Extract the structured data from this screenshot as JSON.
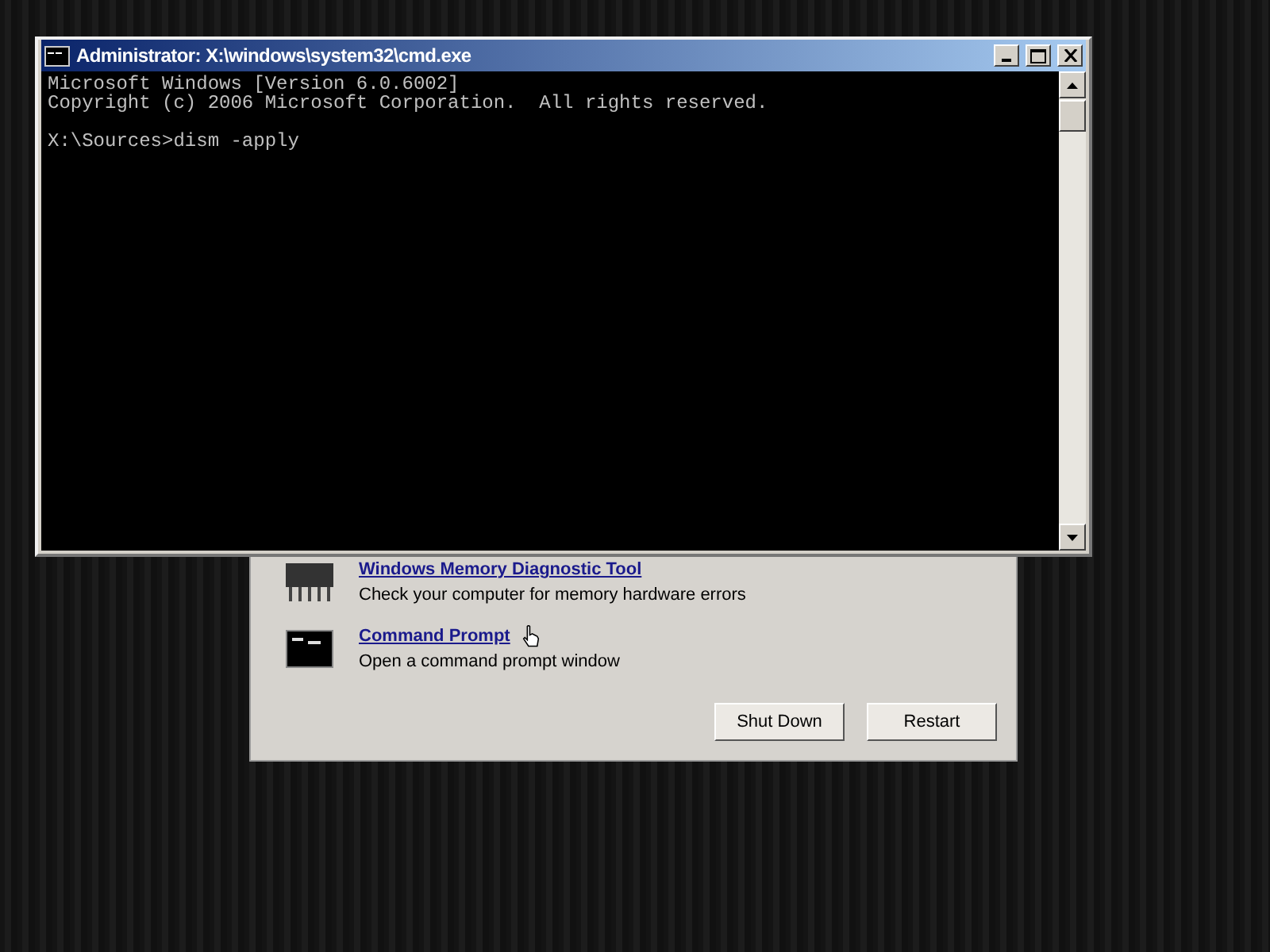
{
  "console_window": {
    "title": "Administrator: X:\\windows\\system32\\cmd.exe",
    "output_lines": [
      "Microsoft Windows [Version 6.0.6002]",
      "Copyright (c) 2006 Microsoft Corporation.  All rights reserved."
    ],
    "prompt_line": "X:\\Sources>dism -apply"
  },
  "recovery_options": {
    "tools": [
      {
        "kind": "memory",
        "link": "Windows Memory Diagnostic Tool",
        "description": "Check your computer for memory hardware errors"
      },
      {
        "kind": "console",
        "link": "Command Prompt",
        "description": "Open a command prompt window"
      }
    ],
    "buttons": [
      "Shut Down",
      "Restart"
    ]
  }
}
